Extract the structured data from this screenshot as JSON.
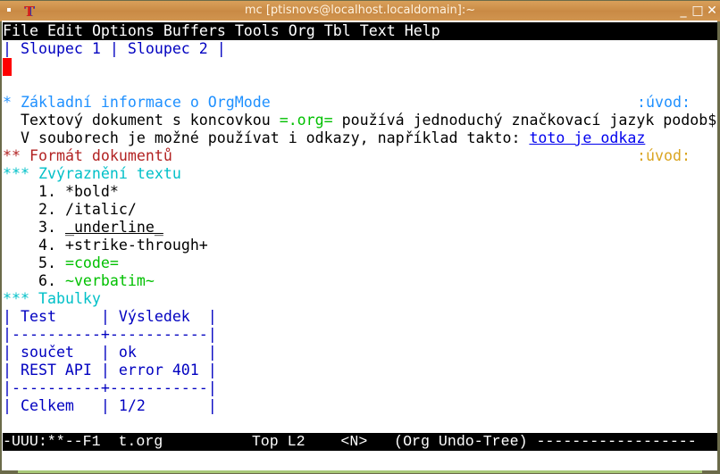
{
  "window": {
    "title": "mc [ptisnovs@localhost.localdomain]:~",
    "icon": "terminal-app-icon",
    "buttons": {
      "minimize": "minimize-icon",
      "maximize": "maximize-icon",
      "close": "close-icon"
    }
  },
  "menu": [
    "File",
    "Edit",
    "Options",
    "Buffers",
    "Tools",
    "Org",
    "Tbl",
    "Text",
    "Help"
  ],
  "buffer": {
    "table_header_line": "| Sloupec 1 | Sloupec 2 |",
    "h1": {
      "stars": "*",
      "title": "Základní informace o OrgMode",
      "tag": ":úvod:"
    },
    "para1": {
      "before": "  Textový dokument s koncovkou ",
      "code": "=.org=",
      "after": " používá jednoduchý značkovací jazyk podob$"
    },
    "para2": {
      "before": "  V souborech je možné používat i odkazy, například takto: ",
      "link": "toto je odkaz"
    },
    "h2": {
      "stars": "**",
      "title": "Formát dokumentů",
      "tag": ":úvod:"
    },
    "h3a": {
      "stars": "***",
      "title": "Zvýraznění textu"
    },
    "list": [
      {
        "num": "1.",
        "text": "*bold*"
      },
      {
        "num": "2.",
        "text": "/italic/"
      },
      {
        "num": "3.",
        "text": "_underline_"
      },
      {
        "num": "4.",
        "text": "+strike-through+"
      },
      {
        "num": "5.",
        "text": "=code="
      },
      {
        "num": "6.",
        "text": "~verbatim~"
      }
    ],
    "h3b": {
      "stars": "***",
      "title": "Tabulky"
    },
    "table": [
      "| Test     | Výsledek  |",
      "|----------+-----------|",
      "| součet   | ok        |",
      "| REST API | error 401 |",
      "|----------+-----------|",
      "| Celkem   | 1/2       |"
    ]
  },
  "modeline": "-UUU:**--F1  t.org          Top L2    <N>   (Org Undo-Tree) ------------------",
  "colors": {
    "cursor": "#ff0000",
    "heading1": "#1e90ff",
    "heading2": "#b22222",
    "heading3": "#00c0c8",
    "code": "#00c000",
    "table": "#0000c0"
  }
}
